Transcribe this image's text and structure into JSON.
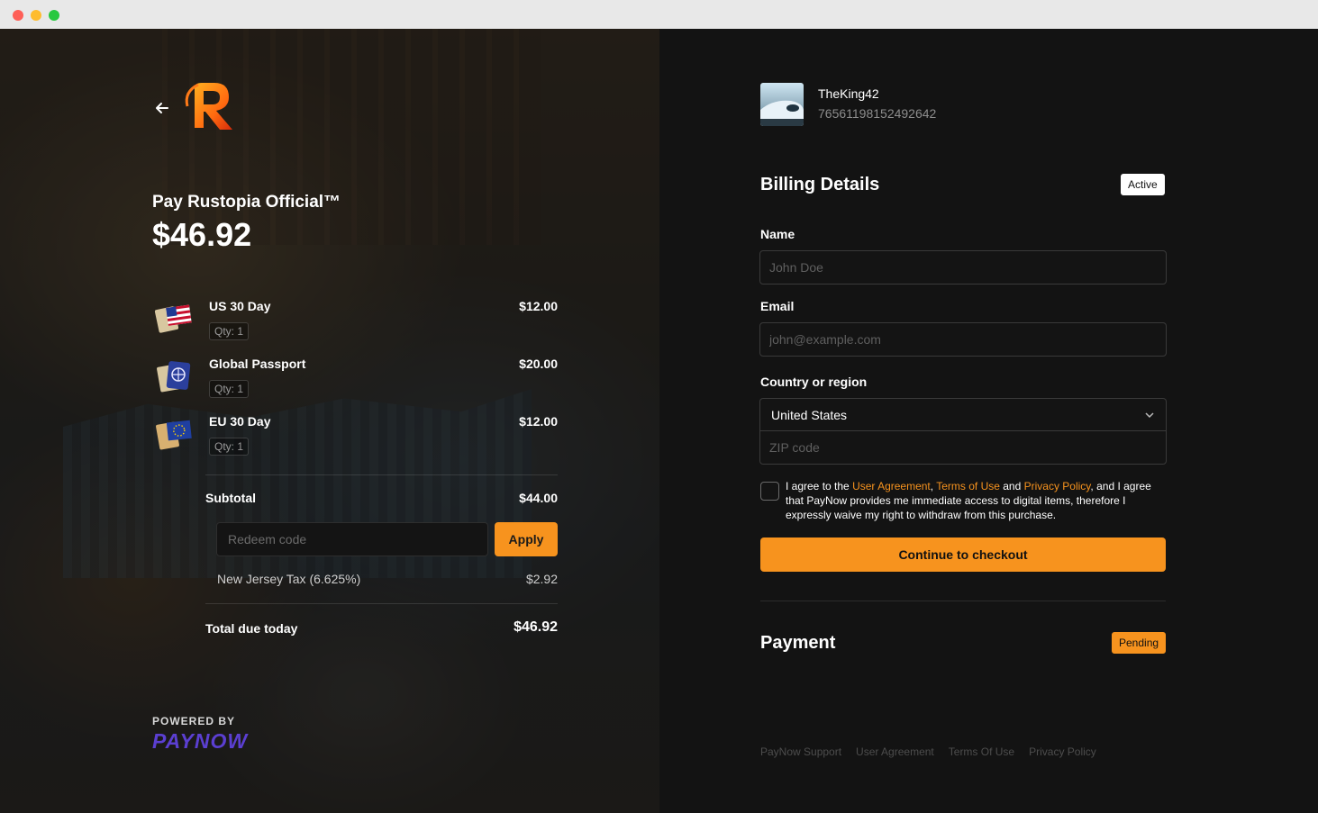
{
  "window": {
    "controls": [
      "close",
      "minimize",
      "maximize"
    ]
  },
  "store": {
    "merchant_title": "Pay Rustopia Official™",
    "total_display": "$46.92",
    "logo_icon": "rustopia-r-logo",
    "back_icon": "arrow-left-icon"
  },
  "cart": {
    "items": [
      {
        "name": "US 30 Day",
        "price": "$12.00",
        "qty": "Qty: 1",
        "icon": "us-flag-item-icon"
      },
      {
        "name": "Global Passport",
        "price": "$20.00",
        "qty": "Qty: 1",
        "icon": "globe-passport-icon"
      },
      {
        "name": "EU 30 Day",
        "price": "$12.00",
        "qty": "Qty: 1",
        "icon": "eu-flag-item-icon"
      }
    ],
    "subtotal_label": "Subtotal",
    "subtotal_value": "$44.00",
    "redeem_placeholder": "Redeem code",
    "apply_label": "Apply",
    "tax_label": "New Jersey Tax (6.625%)",
    "tax_value": "$2.92",
    "total_label": "Total due today",
    "total_value": "$46.92"
  },
  "branding": {
    "powered_by": "POWERED BY",
    "provider": "PAYNOW"
  },
  "user": {
    "name": "TheKing42",
    "id": "76561198152492642"
  },
  "billing": {
    "title": "Billing Details",
    "status": "Active",
    "name_label": "Name",
    "name_placeholder": "John Doe",
    "email_label": "Email",
    "email_placeholder": "john@example.com",
    "country_label": "Country or region",
    "country_value": "United States",
    "zip_placeholder": "ZIP code",
    "agree_prefix": "I agree to the ",
    "link_user_agreement": "User Agreement",
    "sep1": ", ",
    "link_terms": "Terms of Use",
    "sep2": " and ",
    "link_privacy": "Privacy Policy",
    "agree_rest": ", and I agree that PayNow provides me immediate access to digital items, therefore I expressly waive my right to withdraw from this purchase.",
    "checkout_label": "Continue to checkout"
  },
  "payment": {
    "title": "Payment",
    "status": "Pending"
  },
  "footer": {
    "links": [
      "PayNow Support",
      "User Agreement",
      "Terms Of Use",
      "Privacy Policy"
    ]
  },
  "colors": {
    "accent": "#f7931e",
    "panel_dark": "#131313",
    "provider_purple": "#5b3fd1"
  }
}
